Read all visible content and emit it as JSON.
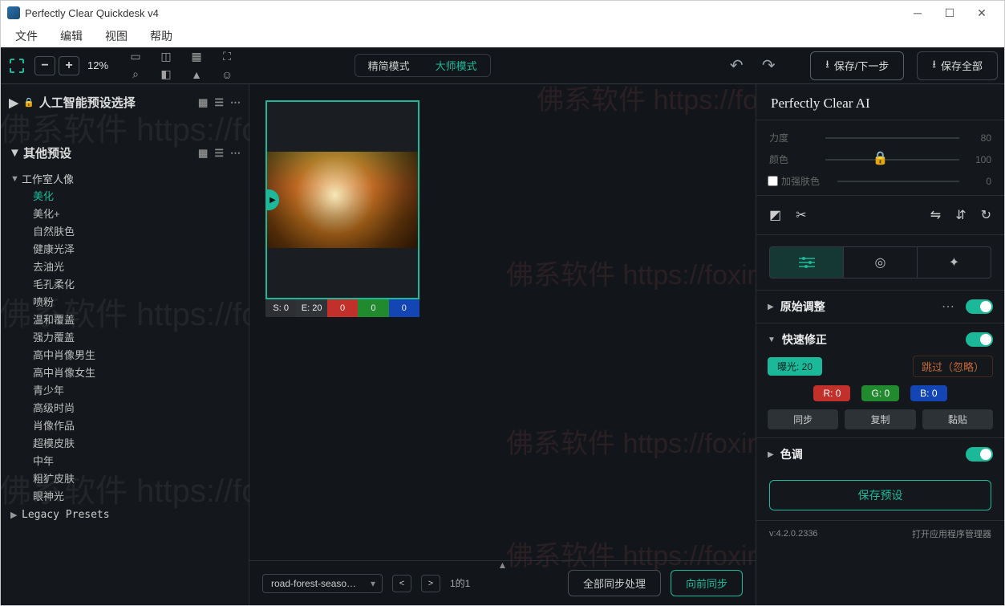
{
  "window": {
    "title": "Perfectly Clear Quickdesk v4"
  },
  "menu": {
    "file": "文件",
    "edit": "编辑",
    "view": "视图",
    "help": "帮助"
  },
  "toolbar": {
    "zoom_out": "−",
    "zoom_in": "+",
    "zoom_pct": "12%",
    "mode_simple": "精简模式",
    "mode_master": "大师模式",
    "undo": "↶",
    "redo": "↷",
    "save_next": "保存/下一步",
    "save_all": "保存全部"
  },
  "left": {
    "ai_presets_title": "人工智能预设选择",
    "other_presets_title": "其他预设",
    "studio_cat": "工作室人像",
    "studio_items": [
      "美化",
      "美化+",
      "自然肤色",
      "健康光泽",
      "去油光",
      "毛孔柔化",
      "喷粉",
      "温和覆盖",
      "强力覆盖",
      "高中肖像男生",
      "高中肖像女生",
      "青少年",
      "高级时尚",
      "肖像作品",
      "超模皮肤",
      "中年",
      "粗犷皮肤",
      "眼神光"
    ],
    "active_item_index": 0,
    "legacy_cat": "Legacy Presets"
  },
  "thumb": {
    "s_label": "S: 0",
    "e_label": "E: 20",
    "r_val": "0",
    "g_val": "0",
    "b_val": "0"
  },
  "centerbottom": {
    "filename": "road-forest-season-au",
    "page_info": "1的1",
    "sync_all": "全部同步处理",
    "sync_forward": "向前同步"
  },
  "right": {
    "ai_title": "Perfectly Clear AI",
    "ai_strength_label": "力度",
    "ai_strength_val": "80",
    "ai_color_label": "颜色",
    "ai_color_val": "100",
    "ai_skin_label": "加强肤色",
    "ai_skin_val": "0",
    "orig_adjust": "原始调整",
    "quick_fix": "快速修正",
    "exposure_chip": "曝光: 20",
    "skip_chip": "跳过（忽略）",
    "r_chip": "R: 0",
    "g_chip": "G: 0",
    "b_chip": "B: 0",
    "sync_btn": "同步",
    "copy_btn": "复制",
    "paste_btn": "黏贴",
    "tone": "色调",
    "save_preset": "保存预设",
    "version": "v:4.2.0.2336",
    "task_mgr": "打开应用程序管理器"
  }
}
